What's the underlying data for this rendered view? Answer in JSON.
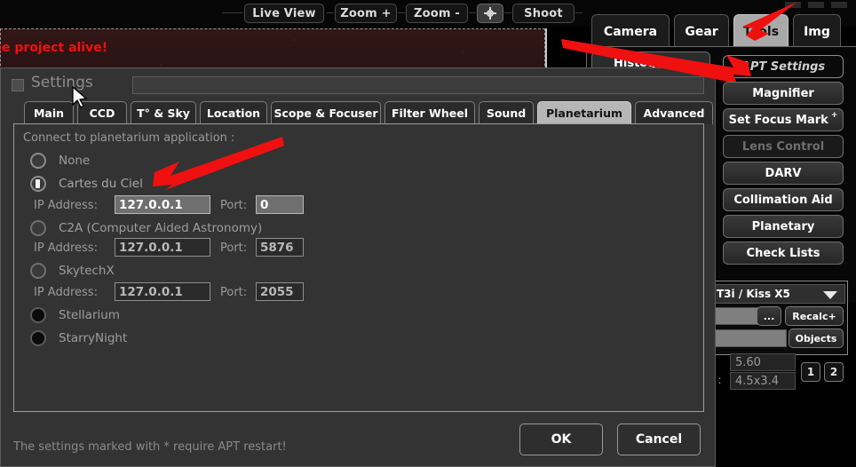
{
  "app": {
    "image_banner_text": "he project alive!"
  },
  "toolbar": {
    "buttons": [
      {
        "label": "Live View",
        "name": "live-view-button"
      },
      {
        "label": "Zoom +",
        "name": "zoom-in-button"
      },
      {
        "label": "Zoom -",
        "name": "zoom-out-button"
      },
      {
        "label": "",
        "name": "crosshair-target-button"
      },
      {
        "label": "Shoot",
        "name": "shoot-button"
      }
    ]
  },
  "right_panel": {
    "tabs": [
      {
        "label": "Camera",
        "active": false
      },
      {
        "label": "Gear",
        "active": false
      },
      {
        "label": "Tools",
        "active": true
      },
      {
        "label": "Img",
        "active": false
      }
    ],
    "histograms_label": "Histograms",
    "buttons": [
      {
        "label": "APT Settings",
        "state": "highlighted"
      },
      {
        "label": "Magnifier",
        "state": "normal"
      },
      {
        "label": "Set Focus Mark",
        "sup": "+",
        "state": "normal"
      },
      {
        "label": "Lens Control",
        "state": "disabled"
      },
      {
        "label": "DARV",
        "state": "normal"
      },
      {
        "label": "Collimation Aid",
        "state": "normal"
      },
      {
        "label": "Planetary",
        "state": "normal"
      },
      {
        "label": "Check Lists",
        "state": "normal"
      }
    ],
    "camera_model": "T3i / Kiss X5",
    "browse_label": "...",
    "recalc_label": "Recalc",
    "recalc_sup": "+",
    "objects_label": "Objects",
    "focal_value": "5.60",
    "pixel_label": ") :",
    "pixel_value": "4.5x3.4",
    "num_buttons": [
      "1",
      "2"
    ]
  },
  "dialog": {
    "title": "Settings",
    "tabs": [
      {
        "label": "Main",
        "active": false
      },
      {
        "label": "CCD",
        "active": false
      },
      {
        "label": "T° & Sky",
        "active": false
      },
      {
        "label": "Location",
        "active": false
      },
      {
        "label": "Scope & Focuser",
        "active": false
      },
      {
        "label": "Filter Wheel",
        "active": false
      },
      {
        "label": "Sound",
        "active": false
      },
      {
        "label": "Planetarium",
        "active": true
      },
      {
        "label": "Advanced",
        "active": false
      }
    ],
    "group_label": "Connect to planetarium application :",
    "options": [
      {
        "label": "None",
        "selected": false,
        "style": "ring"
      },
      {
        "label": "Cartes du Ciel",
        "selected": true,
        "style": "ring"
      },
      {
        "label": "C2A (Computer Aided Astronomy)",
        "selected": false,
        "style": "dim"
      },
      {
        "label": "SkytechX",
        "selected": false,
        "style": "dim"
      },
      {
        "label": "Stellarium",
        "selected": false,
        "style": "black"
      },
      {
        "label": "StarryNight",
        "selected": false,
        "style": "black"
      }
    ],
    "connections": [
      {
        "ip_label": "IP Address:",
        "ip_value": "127.0.0.1",
        "port_label": "Port:",
        "port_value": "0",
        "active": true
      },
      {
        "ip_label": "IP Address:",
        "ip_value": "127.0.0.1",
        "port_label": "Port:",
        "port_value": "5876",
        "active": false
      },
      {
        "ip_label": "IP Address:",
        "ip_value": "127.0.0.1",
        "port_label": "Port:",
        "port_value": "2055",
        "active": false
      }
    ],
    "note": "The settings marked with * require APT restart!",
    "ok_label": "OK",
    "cancel_label": "Cancel"
  },
  "colors": {
    "accent_red": "#fb0d0d",
    "dialog_bg": "#333333",
    "active_tab": "#b6b6b6"
  }
}
